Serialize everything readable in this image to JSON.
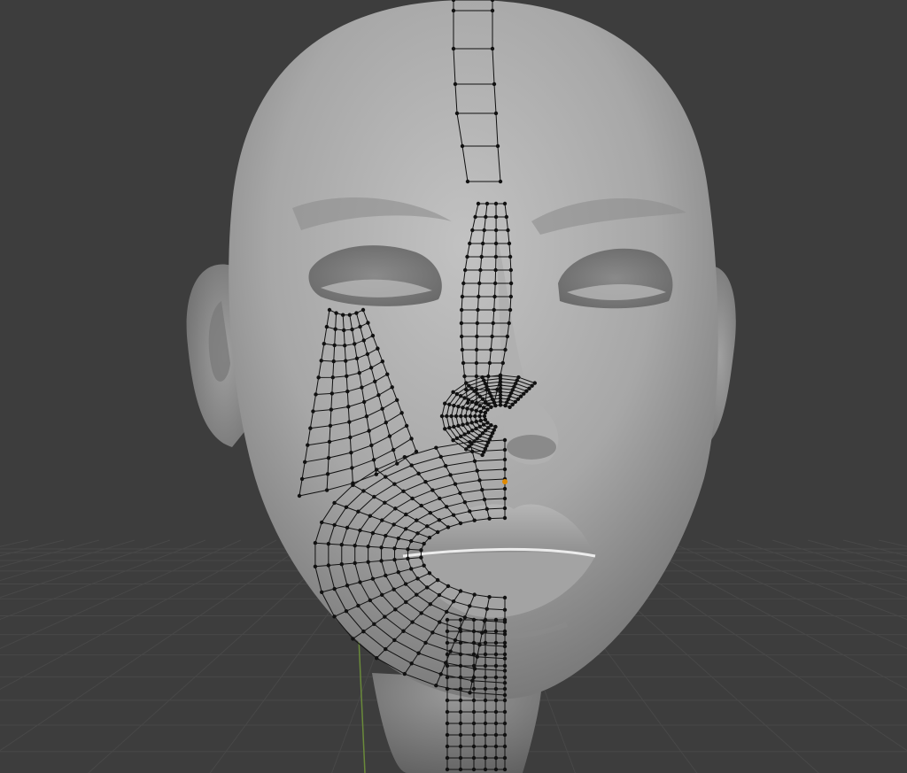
{
  "viewport": {
    "background_color": "#3d3d3d",
    "grid_color": "#484848",
    "y_axis_color": "#6a8a3a",
    "mesh_surface_color": "#a9a9a9",
    "wireframe_color": "#111111",
    "active_vertex_color": "#e08a00"
  },
  "scene": {
    "object": "head-sculpt-mesh",
    "mode": "edit-retopology",
    "mirror_axis": "x"
  }
}
